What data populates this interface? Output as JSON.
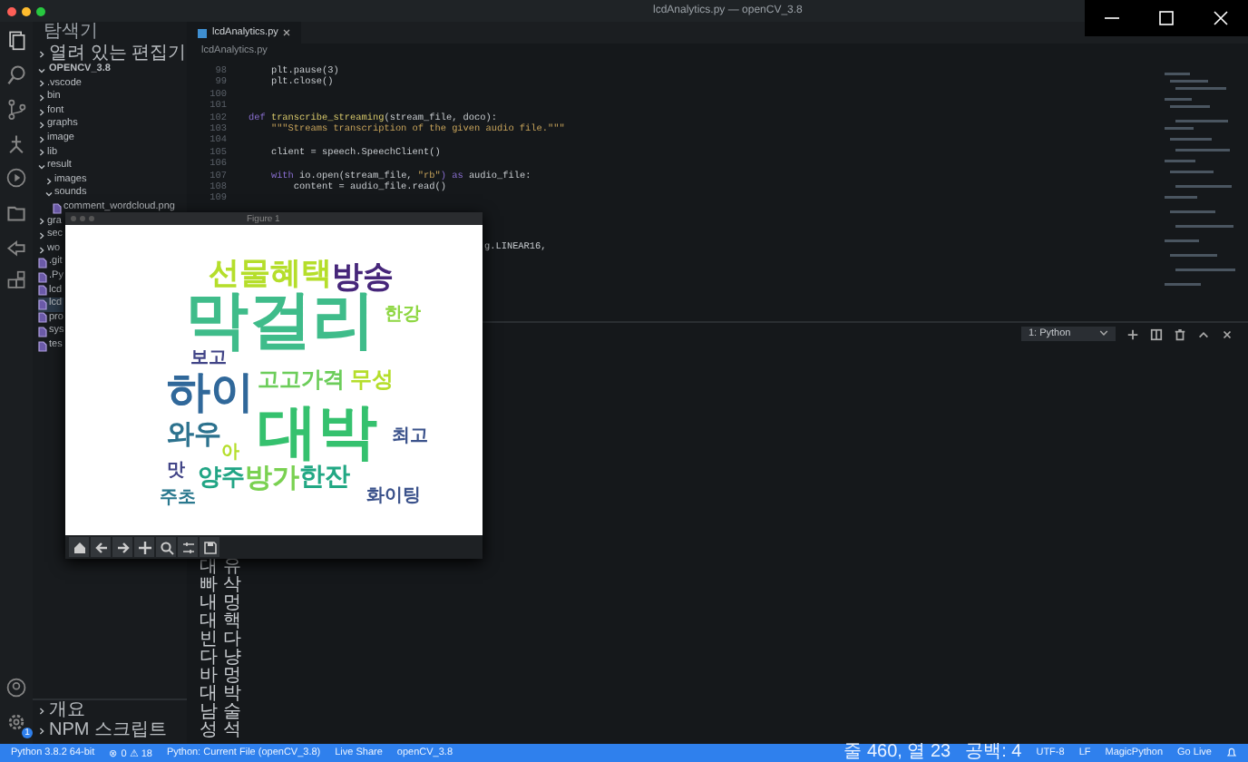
{
  "window": {
    "title": "lcdAnalytics.py — openCV_3.8"
  },
  "activity_bar": {
    "settings_badge": "1"
  },
  "sidebar": {
    "title": "탐색기",
    "open_editors": {
      "label": "열려 있는 편집기",
      "expanded": false
    },
    "project": {
      "label": "OPENCV_3.8",
      "expanded": true
    },
    "items": [
      {
        "label": ".vscode",
        "kind": "folder",
        "expanded": false,
        "selected": false
      },
      {
        "label": "bin",
        "kind": "folder",
        "expanded": false,
        "selected": false
      },
      {
        "label": "font",
        "kind": "folder",
        "expanded": false,
        "selected": false
      },
      {
        "label": "graphs",
        "kind": "folder",
        "expanded": false,
        "selected": false
      },
      {
        "label": "image",
        "kind": "folder",
        "expanded": false,
        "selected": false
      },
      {
        "label": "lib",
        "kind": "folder",
        "expanded": false,
        "selected": false
      },
      {
        "label": "result",
        "kind": "folder",
        "expanded": true,
        "selected": false,
        "children": [
          {
            "label": "images",
            "kind": "folder",
            "expanded": false,
            "selected": false
          },
          {
            "label": "sounds",
            "kind": "folder",
            "expanded": true,
            "selected": false,
            "children": [
              {
                "label": "comment_wordcloud.png",
                "kind": "file",
                "selected": false
              }
            ]
          }
        ]
      },
      {
        "label": "gra",
        "kind": "folder",
        "expanded": false,
        "selected": false
      },
      {
        "label": "sec",
        "kind": "folder",
        "expanded": false,
        "selected": false
      },
      {
        "label": "wo",
        "kind": "folder",
        "expanded": false,
        "selected": false
      },
      {
        "label": ".git",
        "kind": "file",
        "selected": false
      },
      {
        "label": ".Py",
        "kind": "file",
        "selected": false
      },
      {
        "label": "lcd",
        "kind": "file",
        "selected": false
      },
      {
        "label": "lcd",
        "kind": "file",
        "selected": true
      },
      {
        "label": "pro",
        "kind": "file",
        "selected": false
      },
      {
        "label": "sys",
        "kind": "file",
        "selected": false
      },
      {
        "label": "tes",
        "kind": "file",
        "selected": false
      }
    ],
    "bottom_sections": [
      {
        "label": "개요",
        "expanded": false
      },
      {
        "label": "NPM 스크립트",
        "expanded": false
      }
    ]
  },
  "editor": {
    "tabs": [
      {
        "label": "lcdAnalytics.py",
        "selected": true
      }
    ],
    "breadcrumb": "lcdAnalytics.py",
    "lines": [
      {
        "number": "98",
        "segments": [
          {
            "text": "    plt.pause(3)",
            "kind": "plain"
          }
        ]
      },
      {
        "number": "99",
        "segments": [
          {
            "text": "    plt.close()",
            "kind": "plain"
          }
        ]
      },
      {
        "number": "100"
      },
      {
        "number": "101"
      },
      {
        "number": "102",
        "segments": [
          {
            "text": "def ",
            "kind": "keyword"
          },
          {
            "text": "transcribe_streaming",
            "kind": "function"
          },
          {
            "text": "(stream_file, doco):",
            "kind": "plain"
          }
        ]
      },
      {
        "number": "103",
        "segments": [
          {
            "text": "    \"\"\"Streams transcription of the given audio file.\"\"\"",
            "kind": "string"
          }
        ]
      },
      {
        "number": "104"
      },
      {
        "number": "105",
        "segments": [
          {
            "text": "    client = speech.SpeechClient()",
            "kind": "plain"
          }
        ]
      },
      {
        "number": "106"
      },
      {
        "number": "107",
        "segments": [
          {
            "text": "    with ",
            "kind": "keyword"
          },
          {
            "text": "io.open(stream_file, ",
            "kind": "plain"
          },
          {
            "text": "\"rb\"",
            "kind": "string"
          },
          {
            "text": ") as ",
            "kind": "keyword"
          },
          {
            "text": "audio_file:",
            "kind": "plain"
          }
        ]
      },
      {
        "number": "108",
        "segments": [
          {
            "text": "        content = audio_file.read()",
            "kind": "plain"
          }
        ]
      },
      {
        "number": "109"
      }
    ],
    "code_fragment": "g.LINEAR16,"
  },
  "figure": {
    "title": "Figure 1",
    "words": [
      {
        "text": "선물혜택",
        "color": "#b5de2b"
      },
      {
        "text": "방송",
        "color": "#46267a"
      },
      {
        "text": "막걸리",
        "color": "#3fbc8a"
      },
      {
        "text": "한강",
        "color": "#8fd744"
      },
      {
        "text": "보고",
        "color": "#414487"
      },
      {
        "text": "하이",
        "color": "#30689a"
      },
      {
        "text": "고고가격",
        "color": "#6ccd5a"
      },
      {
        "text": "무성",
        "color": "#b5de2b"
      },
      {
        "text": "와우",
        "color": "#2c728e"
      },
      {
        "text": "아",
        "color": "#b5de2b"
      },
      {
        "text": "대박",
        "color": "#35c16e"
      },
      {
        "text": "최고",
        "color": "#3b528b"
      },
      {
        "text": "맛",
        "color": "#414487"
      },
      {
        "text": "양주",
        "color": "#21a585"
      },
      {
        "text": "방가",
        "color": "#7ad151"
      },
      {
        "text": "한잔",
        "color": "#22a884"
      },
      {
        "text": "주초",
        "color": "#2a788e"
      },
      {
        "text": "화이팅",
        "color": "#3b528b"
      }
    ]
  },
  "terminal": {
    "shell": "1: Python",
    "lines": [
      "대 유",
      "빠 삭",
      "내 멍",
      "대 핵",
      "빈 다",
      "다 냥",
      "바 멍",
      "대 박",
      "남 술",
      "성 석"
    ]
  },
  "status_bar": {
    "left": [
      "Python 3.8.2 64-bit",
      "⊗ 0 ⚠ 18",
      "Python: Current File (openCV_3.8)",
      "Live Share",
      "openCV_3.8"
    ],
    "right": [
      "줄 460, 열 23",
      "공백: 4",
      "UTF-8",
      "LF",
      "MagicPython",
      "Go Live"
    ]
  }
}
